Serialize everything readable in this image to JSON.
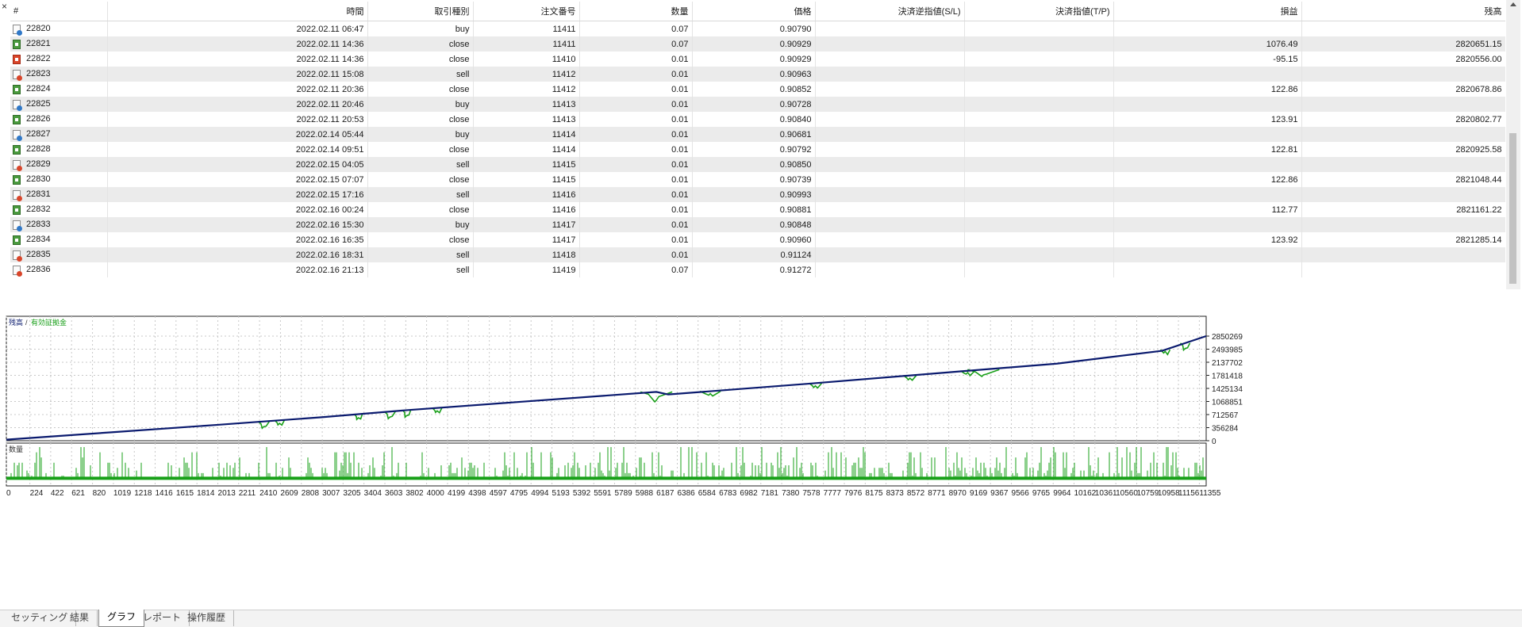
{
  "close_glyph": "×",
  "columns": [
    "#",
    "時間",
    "取引種別",
    "注文番号",
    "数量",
    "価格",
    "決済逆指値(S/L)",
    "決済指値(T/P)",
    "損益",
    "残高"
  ],
  "rows": [
    {
      "id": "22820",
      "time": "2022.02.11 06:47",
      "type": "buy",
      "order": "11411",
      "volume": "0.07",
      "price": "0.90790",
      "sl": "",
      "tp": "",
      "profit": "",
      "balance": "",
      "icon": "buy"
    },
    {
      "id": "22821",
      "time": "2022.02.11 14:36",
      "type": "close",
      "order": "11411",
      "volume": "0.07",
      "price": "0.90929",
      "sl": "",
      "tp": "",
      "profit": "1076.49",
      "balance": "2820651.15",
      "icon": "close"
    },
    {
      "id": "22822",
      "time": "2022.02.11 14:36",
      "type": "close",
      "order": "11410",
      "volume": "0.01",
      "price": "0.90929",
      "sl": "",
      "tp": "",
      "profit": "-95.15",
      "balance": "2820556.00",
      "icon": "close-loss"
    },
    {
      "id": "22823",
      "time": "2022.02.11 15:08",
      "type": "sell",
      "order": "11412",
      "volume": "0.01",
      "price": "0.90963",
      "sl": "",
      "tp": "",
      "profit": "",
      "balance": "",
      "icon": "sell"
    },
    {
      "id": "22824",
      "time": "2022.02.11 20:36",
      "type": "close",
      "order": "11412",
      "volume": "0.01",
      "price": "0.90852",
      "sl": "",
      "tp": "",
      "profit": "122.86",
      "balance": "2820678.86",
      "icon": "close"
    },
    {
      "id": "22825",
      "time": "2022.02.11 20:46",
      "type": "buy",
      "order": "11413",
      "volume": "0.01",
      "price": "0.90728",
      "sl": "",
      "tp": "",
      "profit": "",
      "balance": "",
      "icon": "buy"
    },
    {
      "id": "22826",
      "time": "2022.02.11 20:53",
      "type": "close",
      "order": "11413",
      "volume": "0.01",
      "price": "0.90840",
      "sl": "",
      "tp": "",
      "profit": "123.91",
      "balance": "2820802.77",
      "icon": "close"
    },
    {
      "id": "22827",
      "time": "2022.02.14 05:44",
      "type": "buy",
      "order": "11414",
      "volume": "0.01",
      "price": "0.90681",
      "sl": "",
      "tp": "",
      "profit": "",
      "balance": "",
      "icon": "buy"
    },
    {
      "id": "22828",
      "time": "2022.02.14 09:51",
      "type": "close",
      "order": "11414",
      "volume": "0.01",
      "price": "0.90792",
      "sl": "",
      "tp": "",
      "profit": "122.81",
      "balance": "2820925.58",
      "icon": "close"
    },
    {
      "id": "22829",
      "time": "2022.02.15 04:05",
      "type": "sell",
      "order": "11415",
      "volume": "0.01",
      "price": "0.90850",
      "sl": "",
      "tp": "",
      "profit": "",
      "balance": "",
      "icon": "sell"
    },
    {
      "id": "22830",
      "time": "2022.02.15 07:07",
      "type": "close",
      "order": "11415",
      "volume": "0.01",
      "price": "0.90739",
      "sl": "",
      "tp": "",
      "profit": "122.86",
      "balance": "2821048.44",
      "icon": "close"
    },
    {
      "id": "22831",
      "time": "2022.02.15 17:16",
      "type": "sell",
      "order": "11416",
      "volume": "0.01",
      "price": "0.90993",
      "sl": "",
      "tp": "",
      "profit": "",
      "balance": "",
      "icon": "sell"
    },
    {
      "id": "22832",
      "time": "2022.02.16 00:24",
      "type": "close",
      "order": "11416",
      "volume": "0.01",
      "price": "0.90881",
      "sl": "",
      "tp": "",
      "profit": "112.77",
      "balance": "2821161.22",
      "icon": "close"
    },
    {
      "id": "22833",
      "time": "2022.02.16 15:30",
      "type": "buy",
      "order": "11417",
      "volume": "0.01",
      "price": "0.90848",
      "sl": "",
      "tp": "",
      "profit": "",
      "balance": "",
      "icon": "buy"
    },
    {
      "id": "22834",
      "time": "2022.02.16 16:35",
      "type": "close",
      "order": "11417",
      "volume": "0.01",
      "price": "0.90960",
      "sl": "",
      "tp": "",
      "profit": "123.92",
      "balance": "2821285.14",
      "icon": "close"
    },
    {
      "id": "22835",
      "time": "2022.02.16 18:31",
      "type": "sell",
      "order": "11418",
      "volume": "0.01",
      "price": "0.91124",
      "sl": "",
      "tp": "",
      "profit": "",
      "balance": "",
      "icon": "sell"
    },
    {
      "id": "22836",
      "time": "2022.02.16 21:13",
      "type": "sell",
      "order": "11419",
      "volume": "0.07",
      "price": "0.91272",
      "sl": "",
      "tp": "",
      "profit": "",
      "balance": "",
      "icon": "sell"
    }
  ],
  "tabs": [
    {
      "label": "セッティング",
      "active": false
    },
    {
      "label": "結果",
      "active": false
    },
    {
      "label": "グラフ",
      "active": true
    },
    {
      "label": "レポート",
      "active": false
    },
    {
      "label": "操作履歴",
      "active": false
    }
  ],
  "colors": {
    "balance_line": "#0a1a6e",
    "equity": "#1aa01a",
    "volume_bars": "#18a018",
    "grid": "#c8c8c8"
  },
  "chart_data": {
    "type": "line",
    "upper_legend": [
      "残高",
      "有効証拠金"
    ],
    "lower_label": "数量",
    "y_ticks": [
      0,
      356284,
      712567,
      1068851,
      1425134,
      1781418,
      2137702,
      2493985,
      2850269
    ],
    "x_ticks": [
      0,
      224,
      422,
      621,
      820,
      1019,
      1218,
      1416,
      1615,
      1814,
      2013,
      2211,
      2410,
      2609,
      2808,
      3007,
      3205,
      3404,
      3603,
      3802,
      4000,
      4199,
      4398,
      4597,
      4795,
      4994,
      5193,
      5392,
      5591,
      5789,
      5988,
      6187,
      6386,
      6584,
      6783,
      6982,
      7181,
      7380,
      7578,
      7777,
      7976,
      8175,
      8373,
      8572,
      8771,
      8970,
      9169,
      9367,
      9566,
      9765,
      9964,
      10162,
      10361,
      10560,
      10759,
      10958,
      11156,
      11355
    ],
    "x_range": [
      0,
      11420
    ],
    "y_range": [
      0,
      2850269
    ],
    "series": [
      {
        "name": "残高",
        "x": [
          0,
          1000,
          2000,
          3000,
          3800,
          4800,
          6187,
          6300,
          7600,
          9000,
          10000,
          11000,
          11420
        ],
        "values": [
          30000,
          230000,
          430000,
          640000,
          830000,
          1040000,
          1330000,
          1260000,
          1545000,
          1870000,
          2100000,
          2450000,
          2850269
        ]
      },
      {
        "name": "有効証拠金",
        "drawdowns": [
          {
            "x": 2450,
            "value": 340000,
            "width": 14
          },
          {
            "x": 2600,
            "value": 430000,
            "width": 12
          },
          {
            "x": 3350,
            "value": 580000,
            "width": 10
          },
          {
            "x": 3650,
            "value": 600000,
            "width": 14
          },
          {
            "x": 3810,
            "value": 640000,
            "width": 10
          },
          {
            "x": 4100,
            "value": 770000,
            "width": 12
          },
          {
            "x": 6187,
            "value": 1060000,
            "width": 40
          },
          {
            "x": 6700,
            "value": 1240000,
            "width": 26
          },
          {
            "x": 7700,
            "value": 1450000,
            "width": 16
          },
          {
            "x": 8600,
            "value": 1660000,
            "width": 16
          },
          {
            "x": 9150,
            "value": 1815000,
            "width": 18
          },
          {
            "x": 9300,
            "value": 1750000,
            "width": 40
          },
          {
            "x": 11030,
            "value": 2390000,
            "width": 12
          },
          {
            "x": 11220,
            "value": 2470000,
            "width": 12
          }
        ]
      }
    ],
    "volume": {
      "base": 0.01,
      "max": 0.07
    }
  }
}
